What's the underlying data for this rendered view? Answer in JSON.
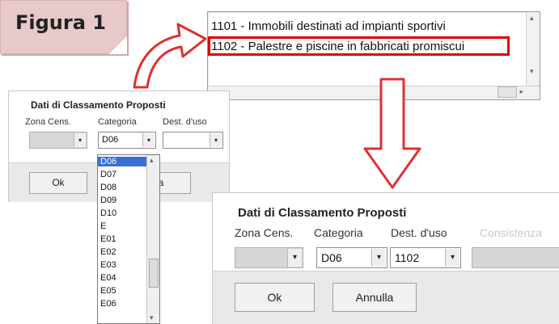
{
  "figure_label": "Figura 1",
  "listbox": {
    "items": [
      "1101 - Immobili destinati ad impianti sportivi",
      "1102 - Palestre e piscine in fabbricati promiscui"
    ],
    "highlighted_index": 1
  },
  "small_panel": {
    "title": "Dati di Classamento Proposti",
    "zona_label": "Zona Cens.",
    "categoria_label": "Categoria",
    "dest_label": "Dest. d'uso",
    "categoria_value": "D06",
    "ok_label": "Ok",
    "annulla_label_visible": "la",
    "dropdown_items": [
      "D06",
      "D07",
      "D08",
      "D09",
      "D10",
      "E",
      "E01",
      "E02",
      "E03",
      "E04",
      "E05",
      "E06"
    ],
    "dropdown_selected": "D06"
  },
  "big_panel": {
    "title": "Dati di Classamento Proposti",
    "zona_label": "Zona Cens.",
    "categoria_label": "Categoria",
    "dest_label": "Dest. d'uso",
    "consistenza_label": "Consistenza",
    "categoria_value": "D06",
    "dest_value": "1102",
    "ok_label": "Ok",
    "annulla_label": "Annulla"
  },
  "colors": {
    "highlight_border": "#e00000",
    "arrow_fill": "#ffffff",
    "arrow_stroke": "#e03030",
    "figure_bg": "#e8c9c9",
    "selected_item_bg": "#3a6fd6"
  },
  "icons": {
    "dropdown": "chevron-down-icon",
    "curved_arrow": "curved-arrow-icon",
    "down_arrow": "down-arrow-icon"
  }
}
